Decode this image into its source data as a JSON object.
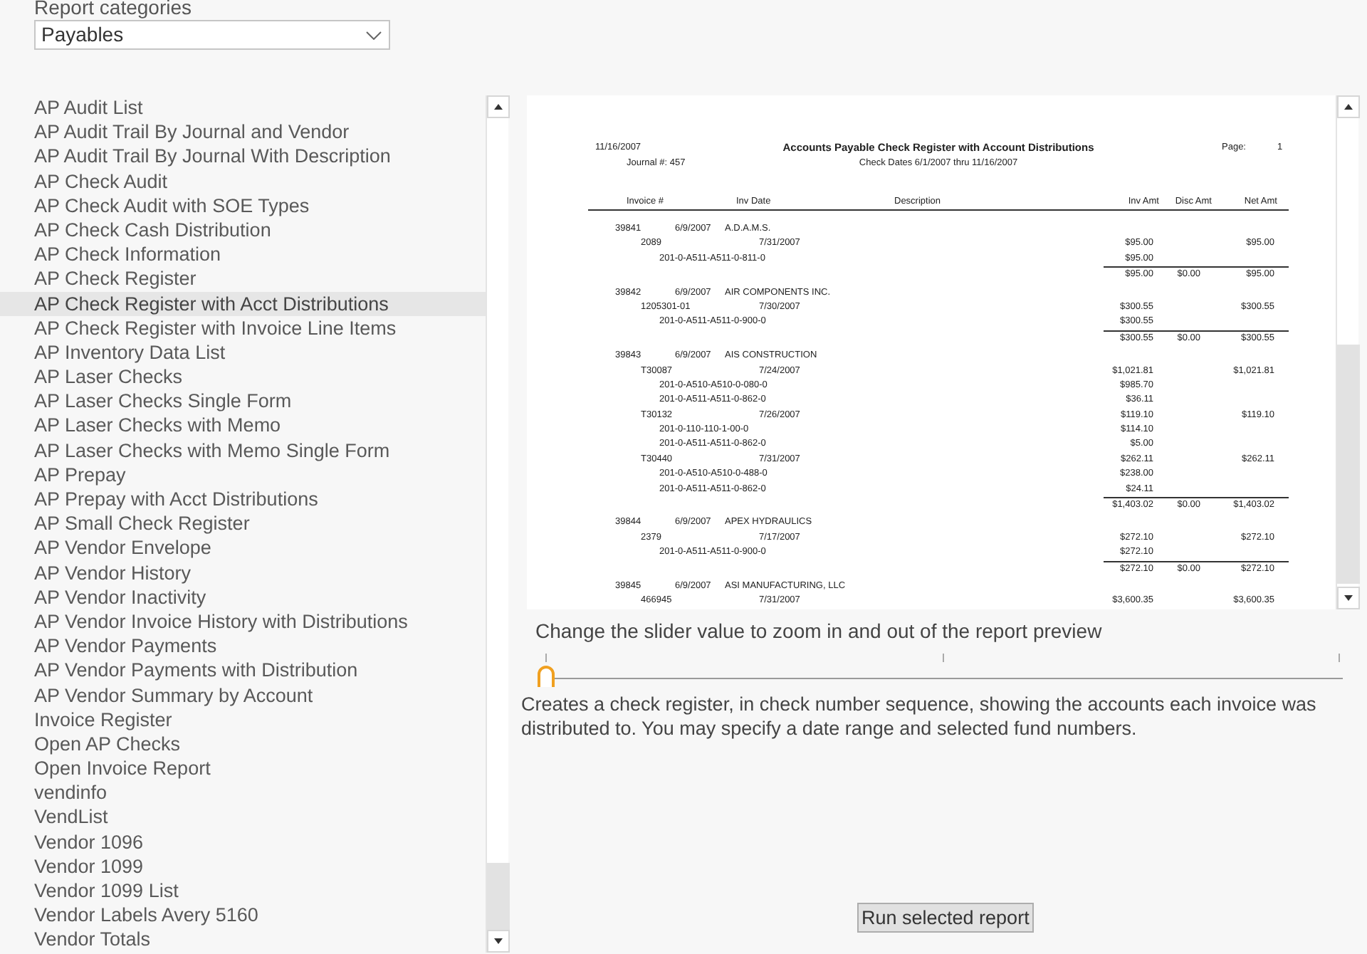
{
  "report_categories": {
    "label": "Report categories",
    "value": "Payables"
  },
  "reports": [
    {
      "name": "AP Audit List",
      "selected": false
    },
    {
      "name": "AP Audit Trail By Journal and Vendor",
      "selected": false
    },
    {
      "name": "AP Audit Trail By Journal With Description",
      "selected": false
    },
    {
      "name": "AP Check Audit",
      "selected": false
    },
    {
      "name": "AP Check Audit with SOE Types",
      "selected": false
    },
    {
      "name": "AP Check Cash Distribution",
      "selected": false
    },
    {
      "name": "AP Check Information",
      "selected": false
    },
    {
      "name": "AP Check Register",
      "selected": false
    },
    {
      "name": "AP Check Register with Acct Distributions",
      "selected": true
    },
    {
      "name": "AP Check Register with Invoice Line Items",
      "selected": false
    },
    {
      "name": "AP Inventory Data List",
      "selected": false
    },
    {
      "name": "AP Laser Checks",
      "selected": false
    },
    {
      "name": "AP Laser Checks Single Form",
      "selected": false
    },
    {
      "name": "AP Laser Checks with Memo",
      "selected": false
    },
    {
      "name": "AP Laser Checks with Memo Single Form",
      "selected": false
    },
    {
      "name": "AP Prepay",
      "selected": false
    },
    {
      "name": "AP Prepay with Acct Distributions",
      "selected": false
    },
    {
      "name": "AP Small Check Register",
      "selected": false
    },
    {
      "name": "AP Vendor Envelope",
      "selected": false
    },
    {
      "name": "AP Vendor History",
      "selected": false
    },
    {
      "name": "AP Vendor Inactivity",
      "selected": false
    },
    {
      "name": "AP Vendor Invoice History with Distributions",
      "selected": false
    },
    {
      "name": "AP Vendor Payments",
      "selected": false
    },
    {
      "name": "AP Vendor Payments with Distribution",
      "selected": false
    },
    {
      "name": "AP Vendor Summary by Account",
      "selected": false
    },
    {
      "name": "Invoice Register",
      "selected": false
    },
    {
      "name": "Open AP Checks",
      "selected": false
    },
    {
      "name": "Open Invoice Report",
      "selected": false
    },
    {
      "name": "vendinfo",
      "selected": false
    },
    {
      "name": "VendList",
      "selected": false
    },
    {
      "name": "Vendor 1096",
      "selected": false
    },
    {
      "name": "Vendor 1099",
      "selected": false
    },
    {
      "name": "Vendor 1099 List",
      "selected": false
    },
    {
      "name": "Vendor Labels Avery 5160",
      "selected": false
    },
    {
      "name": "Vendor Totals",
      "selected": false
    }
  ],
  "preview": {
    "date": "11/16/2007",
    "title": "Accounts Payable Check Register with Account Distributions",
    "page_label": "Page:",
    "page_number": "1",
    "journal": "Journal #: 457",
    "date_range": "Check Dates 6/1/2007 thru 11/16/2007",
    "columns": [
      "Invoice #",
      "Inv Date",
      "Description",
      "Inv Amt",
      "Disc Amt",
      "Net Amt"
    ],
    "checks": [
      {
        "check_no": "39841",
        "date": "6/9/2007",
        "vendor": "A.D.A.M.S.",
        "invoices": [
          {
            "invoice_no": "2089",
            "date": "7/31/2007",
            "inv_amt": "$95.00",
            "net_amt": "$95.00",
            "distributions": [
              {
                "account": "201-0-A511-A511-0-811-0",
                "amount": "$95.00"
              }
            ]
          }
        ],
        "totals": {
          "inv_amt": "$95.00",
          "disc_amt": "$0.00",
          "net_amt": "$95.00"
        }
      },
      {
        "check_no": "39842",
        "date": "6/9/2007",
        "vendor": "AIR COMPONENTS INC.",
        "invoices": [
          {
            "invoice_no": "1205301-01",
            "date": "7/30/2007",
            "inv_amt": "$300.55",
            "net_amt": "$300.55",
            "distributions": [
              {
                "account": "201-0-A511-A511-0-900-0",
                "amount": "$300.55"
              }
            ]
          }
        ],
        "totals": {
          "inv_amt": "$300.55",
          "disc_amt": "$0.00",
          "net_amt": "$300.55"
        }
      },
      {
        "check_no": "39843",
        "date": "6/9/2007",
        "vendor": "AIS CONSTRUCTION",
        "invoices": [
          {
            "invoice_no": "T30087",
            "date": "7/24/2007",
            "inv_amt": "$1,021.81",
            "net_amt": "$1,021.81",
            "distributions": [
              {
                "account": "201-0-A510-A510-0-080-0",
                "amount": "$985.70"
              },
              {
                "account": "201-0-A511-A511-0-862-0",
                "amount": "$36.11"
              }
            ]
          },
          {
            "invoice_no": "T30132",
            "date": "7/26/2007",
            "inv_amt": "$119.10",
            "net_amt": "$119.10",
            "distributions": [
              {
                "account": "201-0-110-110-1-00-0",
                "amount": "$114.10"
              },
              {
                "account": "201-0-A511-A511-0-862-0",
                "amount": "$5.00"
              }
            ]
          },
          {
            "invoice_no": "T30440",
            "date": "7/31/2007",
            "inv_amt": "$262.11",
            "net_amt": "$262.11",
            "distributions": [
              {
                "account": "201-0-A510-A510-0-488-0",
                "amount": "$238.00"
              },
              {
                "account": "201-0-A511-A511-0-862-0",
                "amount": "$24.11"
              }
            ]
          }
        ],
        "totals": {
          "inv_amt": "$1,403.02",
          "disc_amt": "$0.00",
          "net_amt": "$1,403.02"
        }
      },
      {
        "check_no": "39844",
        "date": "6/9/2007",
        "vendor": "APEX HYDRAULICS",
        "invoices": [
          {
            "invoice_no": "2379",
            "date": "7/17/2007",
            "inv_amt": "$272.10",
            "net_amt": "$272.10",
            "distributions": [
              {
                "account": "201-0-A511-A511-0-900-0",
                "amount": "$272.10"
              }
            ]
          }
        ],
        "totals": {
          "inv_amt": "$272.10",
          "disc_amt": "$0.00",
          "net_amt": "$272.10"
        }
      },
      {
        "check_no": "39845",
        "date": "6/9/2007",
        "vendor": "ASI MANUFACTURING, LLC",
        "invoices": [
          {
            "invoice_no": "466945",
            "date": "7/31/2007",
            "inv_amt": "$3,600.35",
            "net_amt": "$3,600.35"
          }
        ]
      }
    ]
  },
  "zoom_slider": {
    "caption": "Change the slider value to zoom in and out of the report preview",
    "level": 0
  },
  "description": "Creates a check register, in check number sequence, showing the accounts each invoice was distributed to. You may specify a date range and selected fund numbers.",
  "run_button": "Run selected report"
}
